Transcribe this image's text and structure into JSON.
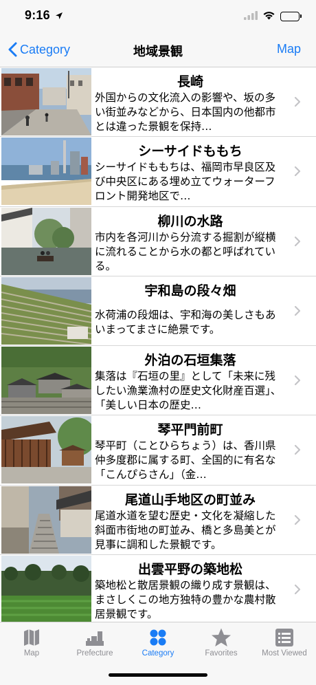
{
  "status_bar": {
    "time": "9:16"
  },
  "nav": {
    "back_label": "Category",
    "title": "地域景観",
    "right_label": "Map"
  },
  "list": {
    "items": [
      {
        "title": "長崎",
        "description": "外国からの文化流入の影響や、坂の多い街並みなどから、日本国内の他都市とは違った景観を保持…",
        "thumb": "nagasaki"
      },
      {
        "title": "シーサイドももち",
        "description": "シーサイドももちは、福岡市早良区及び中央区にある埋め立てウォーターフロント開発地区で…",
        "thumb": "momochi"
      },
      {
        "title": "柳川の水路",
        "description": "市内を各河川から分流する掘割が縦横に流れることから水の都と呼ばれている。",
        "thumb": "yanagawa"
      },
      {
        "title": "宇和島の段々畑",
        "description": "水荷浦の段畑は、宇和海の美しさもあいまってまさに絶景です。",
        "thumb": "uwajima"
      },
      {
        "title": "外泊の石垣集落",
        "description": "集落は『石垣の里』として「未来に残したい漁業漁村の歴史文化財産百選」、「美しい日本の歴史…",
        "thumb": "sotodomari"
      },
      {
        "title": "琴平門前町",
        "description": "琴平町（ことひらちょう）は、香川県仲多度郡に属する町、全国的に有名な「こんぴらさん」（金…",
        "thumb": "kotohira"
      },
      {
        "title": "尾道山手地区の町並み",
        "description": "尾道水道を望む歴史・文化を凝縮した斜面市街地の町並み、橋と多島美とが見事に調和した景観です。",
        "thumb": "onomichi"
      },
      {
        "title": "出雲平野の築地松",
        "description": "築地松と散居景観の織り成す景観は、まさしくこの地方独特の豊かな農村散居景観です。",
        "thumb": "izumo"
      }
    ]
  },
  "tab_bar": {
    "tabs": [
      {
        "label": "Map",
        "icon": "map-icon",
        "active": false
      },
      {
        "label": "Prefecture",
        "icon": "prefecture-icon",
        "active": false
      },
      {
        "label": "Category",
        "icon": "category-grid-icon",
        "active": true
      },
      {
        "label": "Favorites",
        "icon": "star-icon",
        "active": false
      },
      {
        "label": "Most Viewed",
        "icon": "list-icon",
        "active": false
      }
    ]
  },
  "colors": {
    "accent": "#1a7cf5",
    "inactive": "#8e8e93",
    "bar_background": "#f7f7f7"
  }
}
